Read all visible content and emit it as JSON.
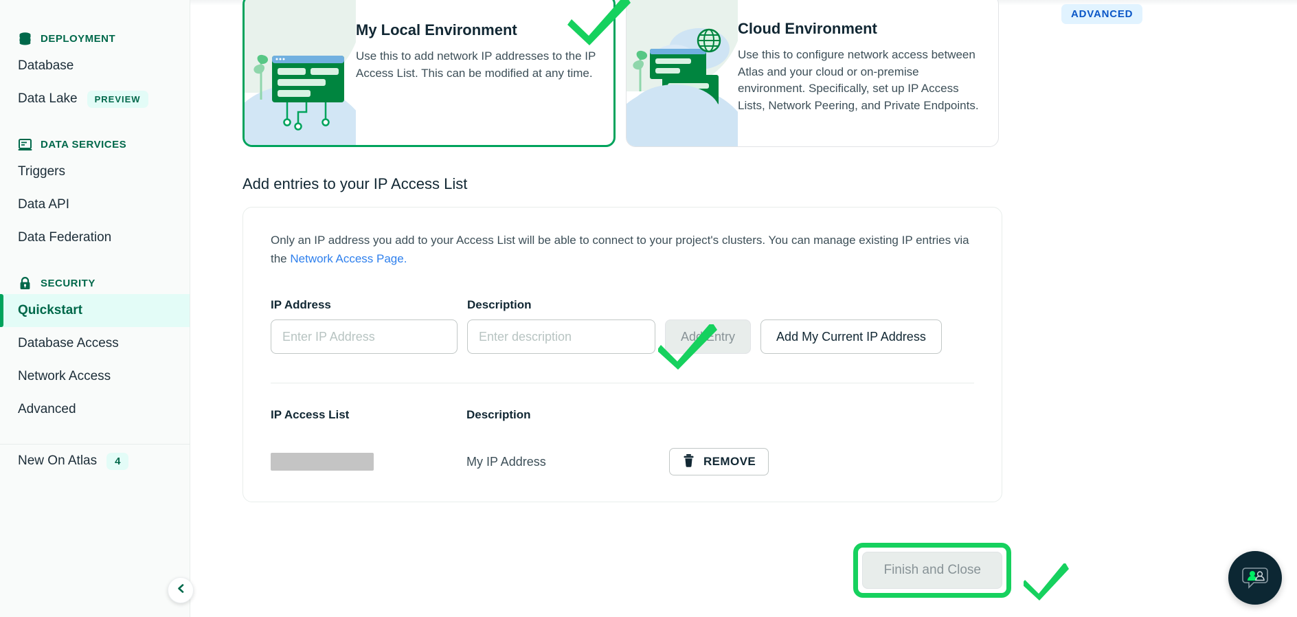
{
  "sidebar": {
    "groups": [
      {
        "title": "DEPLOYMENT",
        "icon": "database-icon",
        "items": [
          {
            "label": "Database",
            "badge": null
          },
          {
            "label": "Data Lake",
            "badge": "PREVIEW"
          }
        ]
      },
      {
        "title": "DATA SERVICES",
        "icon": "window-icon",
        "items": [
          {
            "label": "Triggers",
            "badge": null
          },
          {
            "label": "Data API",
            "badge": null
          },
          {
            "label": "Data Federation",
            "badge": null
          }
        ]
      },
      {
        "title": "SECURITY",
        "icon": "lock-icon",
        "items": [
          {
            "label": "Quickstart",
            "badge": null,
            "active": true
          },
          {
            "label": "Database Access",
            "badge": null
          },
          {
            "label": "Network Access",
            "badge": null
          },
          {
            "label": "Advanced",
            "badge": null
          }
        ]
      }
    ],
    "footer": {
      "label": "New On Atlas",
      "count": "4"
    },
    "collapse_icon": "chevron-left-icon"
  },
  "environment_cards": {
    "advanced_badge": "ADVANCED",
    "cards": [
      {
        "title": "My Local Environment",
        "description": "Use this to add network IP addresses to the IP Access List. This can be modified at any time.",
        "selected": true
      },
      {
        "title": "Cloud Environment",
        "description": "Use this to configure network access between Atlas and your cloud or on-premise environment. Specifically, set up IP Access Lists, Network Peering, and Private Endpoints.",
        "selected": false
      }
    ]
  },
  "access_list": {
    "section_title": "Add entries to your IP Access List",
    "note_before_link": "Only an IP address you add to your Access List will be able to connect to your project's clusters. You can manage existing IP entries via the ",
    "note_link": "Network Access Page.",
    "form": {
      "ip_label": "IP Address",
      "ip_placeholder": "Enter IP Address",
      "ip_value": "",
      "desc_label": "Description",
      "desc_placeholder": "Enter description",
      "desc_value": "",
      "add_entry_label": "Add Entry",
      "add_current_ip_label": "Add My Current IP Address"
    },
    "table": {
      "headers": [
        "IP Access List",
        "Description"
      ],
      "rows": [
        {
          "ip": "",
          "ip_redacted": true,
          "description": "My IP Address",
          "action_label": "REMOVE",
          "action_icon": "trash-icon"
        }
      ]
    }
  },
  "footer": {
    "finish_label": "Finish and Close"
  },
  "chat": {
    "icon": "chat-people-icon"
  },
  "colors": {
    "brand_green": "#00684a",
    "accent_green": "#00a35c",
    "highlight_green": "#16d15e",
    "active_bg": "#e3fcf7",
    "link_blue": "#2f80ed",
    "badge_blue_bg": "#e1f3ff",
    "badge_blue_text": "#0b57c7"
  }
}
